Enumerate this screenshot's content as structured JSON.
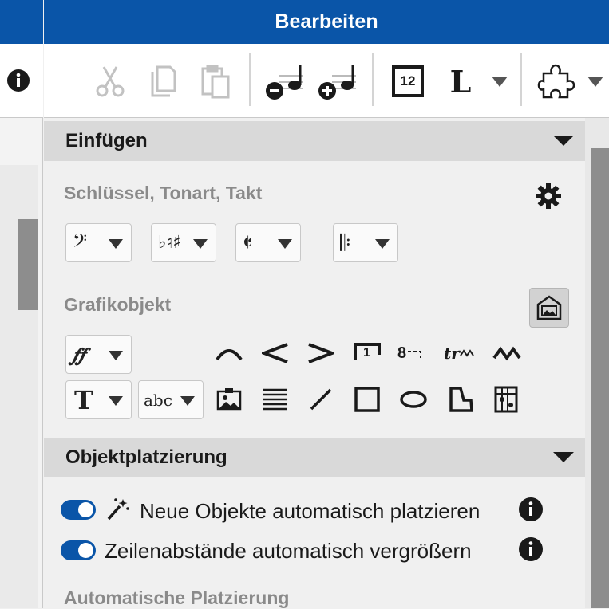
{
  "window": {
    "title": "Bearbeiten"
  },
  "toolbar": {
    "items": [
      "cut-icon",
      "copy-icon",
      "paste-icon",
      "remove-note-icon",
      "add-note-icon",
      "number-box-icon",
      "layout-L-icon",
      "plugin-icon"
    ],
    "number_box_label": "12",
    "layout_label": "L"
  },
  "sections": {
    "einfuegen": {
      "title": "Einfügen",
      "keys_title": "Schlüssel, Tonart, Takt",
      "dropdowns_keys": [
        {
          "glyph": "𝄢",
          "name": "clef"
        },
        {
          "glyph": "♭♮♯",
          "name": "key-signature"
        },
        {
          "glyph": "𝄵",
          "name": "time-signature"
        },
        {
          "glyph": "𝄆",
          "name": "barline"
        }
      ],
      "graphic_title": "Grafikobjekt",
      "dynamics_glyph": "𝆑𝆑",
      "text_glyph": "T",
      "lyrics_glyph": "abc",
      "symbols_row1": [
        "slur-icon",
        "crescendo-icon",
        "decrescendo-icon",
        "volta-bracket-icon",
        "octave-line-icon",
        "trill-icon",
        "vibrato-icon"
      ],
      "symbols_row2": [
        "image-icon",
        "staff-lines-icon",
        "line-icon",
        "rectangle-icon",
        "ellipse-icon",
        "polygon-icon",
        "chord-grid-icon"
      ],
      "volta_label": "1",
      "octave_label": "8",
      "trill_label": "tr"
    },
    "objektplatzierung": {
      "title": "Objektplatzierung",
      "rows": [
        {
          "text": "Neue Objekte automatisch platzieren",
          "enabled": true
        },
        {
          "text": "Zeilenabstände automatisch vergrößern",
          "enabled": true
        }
      ],
      "auto_title": "Automatische Platzierung"
    }
  },
  "colors": {
    "accent": "#0a55a8",
    "header_bg": "#d9d9d9",
    "disabled": "#c2c2c2"
  }
}
